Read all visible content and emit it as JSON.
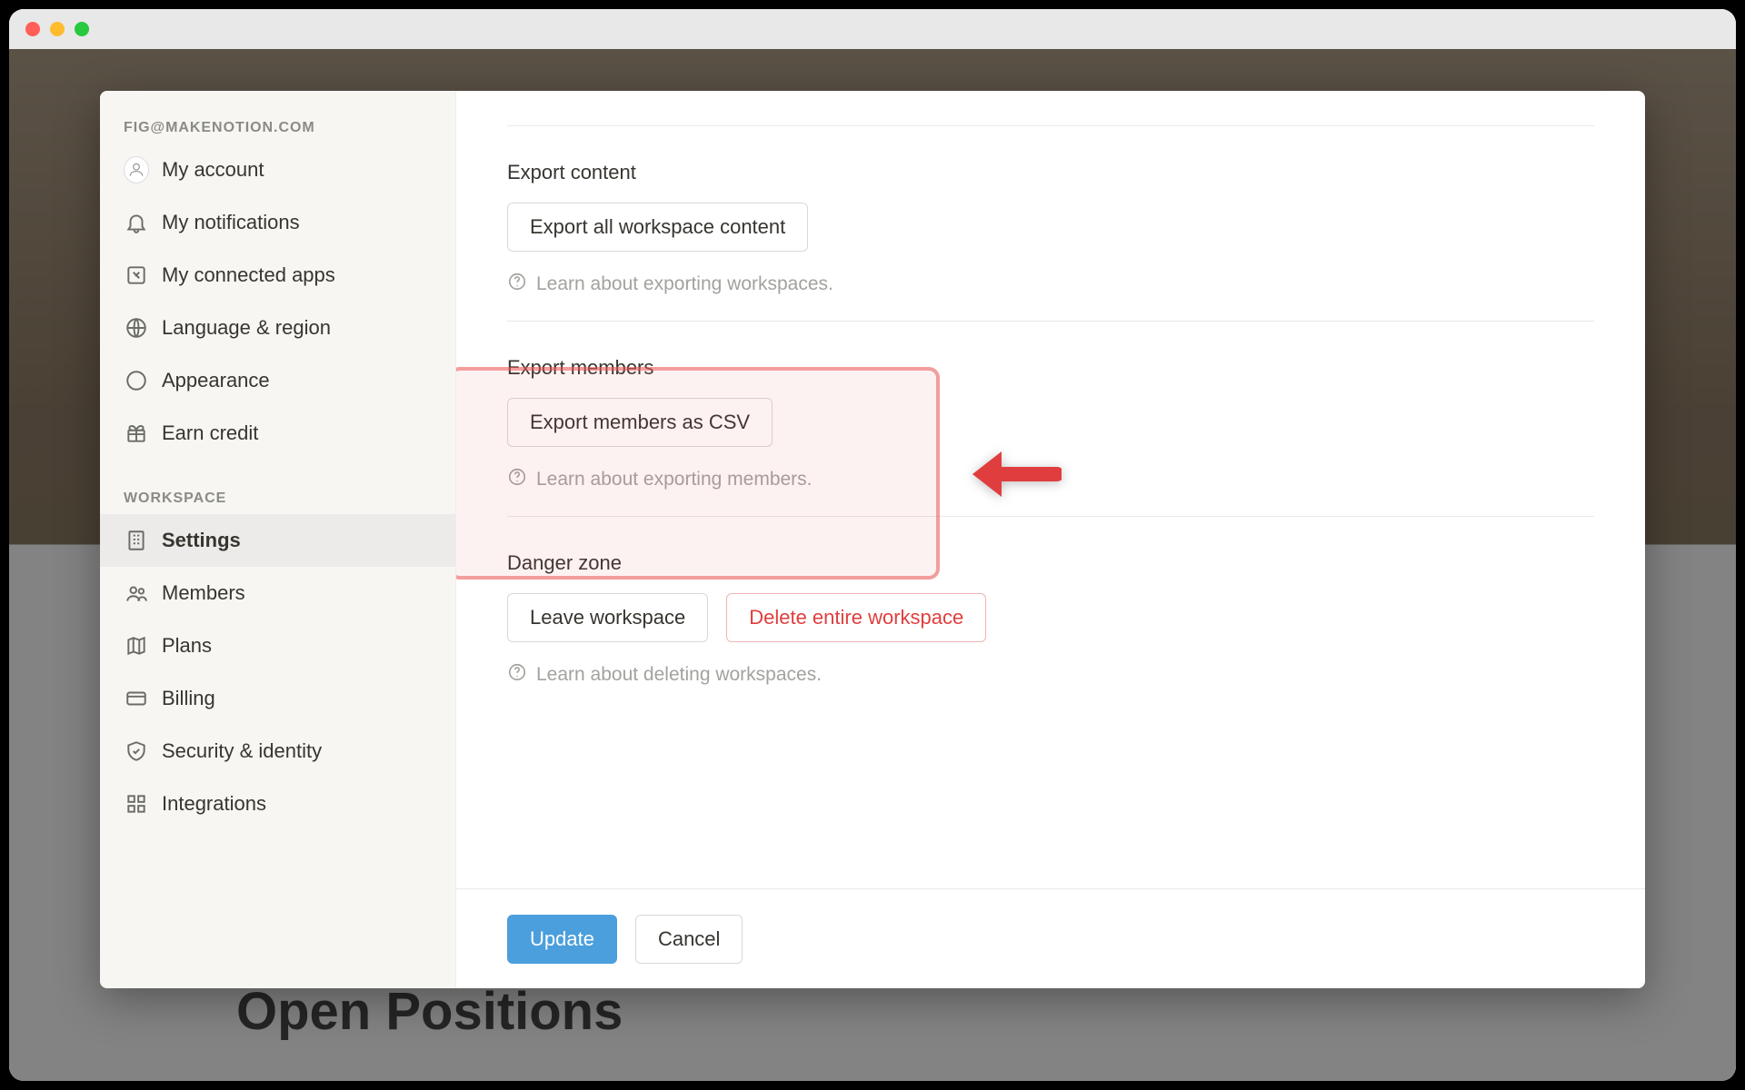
{
  "background_page": {
    "title": "Open Positions"
  },
  "sidebar": {
    "account_label": "FIG@MAKENOTION.COM",
    "workspace_label": "WORKSPACE",
    "account_items": [
      {
        "label": "My account",
        "icon": "avatar"
      },
      {
        "label": "My notifications",
        "icon": "bell-icon"
      },
      {
        "label": "My connected apps",
        "icon": "apps-icon"
      },
      {
        "label": "Language & region",
        "icon": "globe-icon"
      },
      {
        "label": "Appearance",
        "icon": "moon-icon"
      },
      {
        "label": "Earn credit",
        "icon": "gift-icon"
      }
    ],
    "workspace_items": [
      {
        "label": "Settings",
        "icon": "building-icon",
        "active": true
      },
      {
        "label": "Members",
        "icon": "members-icon"
      },
      {
        "label": "Plans",
        "icon": "map-icon"
      },
      {
        "label": "Billing",
        "icon": "card-icon"
      },
      {
        "label": "Security & identity",
        "icon": "shield-icon"
      },
      {
        "label": "Integrations",
        "icon": "grid-icon"
      }
    ]
  },
  "sections": {
    "export_content": {
      "heading": "Export content",
      "button": "Export all workspace content",
      "help": "Learn about exporting workspaces."
    },
    "export_members": {
      "heading": "Export members",
      "button": "Export members as CSV",
      "help": "Learn about exporting members."
    },
    "danger_zone": {
      "heading": "Danger zone",
      "leave_button": "Leave workspace",
      "delete_button": "Delete entire workspace",
      "help": "Learn about deleting workspaces."
    }
  },
  "footer": {
    "update": "Update",
    "cancel": "Cancel"
  },
  "annotation": {
    "highlighted_section": "export_members",
    "arrow_direction": "left",
    "arrow_color": "#e03e3e"
  }
}
